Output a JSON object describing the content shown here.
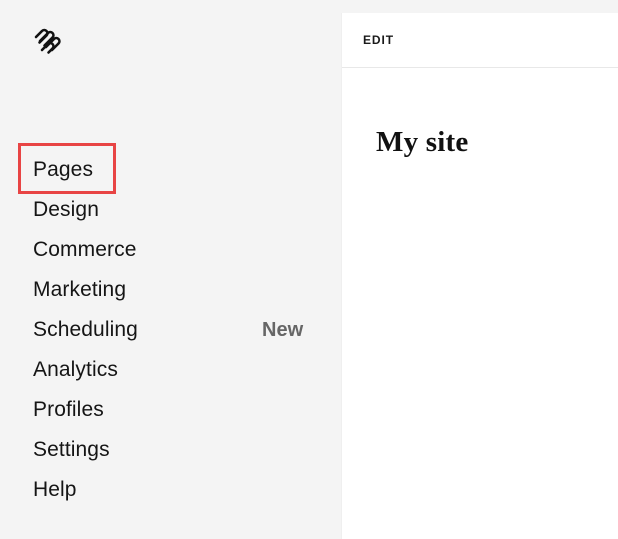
{
  "sidebar": {
    "logo_icon": "squarespace-logo-icon",
    "items": [
      {
        "label": "Pages",
        "badge": ""
      },
      {
        "label": "Design",
        "badge": ""
      },
      {
        "label": "Commerce",
        "badge": ""
      },
      {
        "label": "Marketing",
        "badge": ""
      },
      {
        "label": "Scheduling",
        "badge": "New"
      },
      {
        "label": "Analytics",
        "badge": ""
      },
      {
        "label": "Profiles",
        "badge": ""
      },
      {
        "label": "Settings",
        "badge": ""
      },
      {
        "label": "Help",
        "badge": ""
      }
    ],
    "highlight_color": "#e84444"
  },
  "preview": {
    "header_label": "EDIT",
    "site_title": "My site"
  }
}
